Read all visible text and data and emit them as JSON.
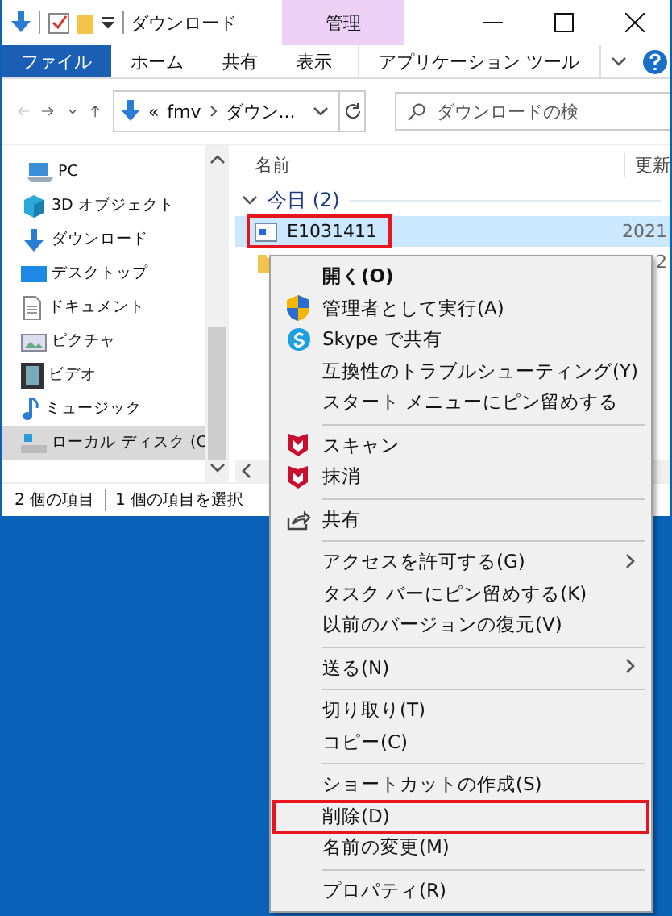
{
  "title_bar": {
    "title": "ダウンロード",
    "context_group": "管理"
  },
  "ribbon_tabs": [
    {
      "label": "ファイル",
      "kind": "file"
    },
    {
      "label": "ホーム",
      "kind": "tab"
    },
    {
      "label": "共有",
      "kind": "tab"
    },
    {
      "label": "表示",
      "kind": "tab"
    },
    {
      "label": "アプリケーション ツール",
      "kind": "context"
    }
  ],
  "address_bar": {
    "overflow": "«",
    "path": [
      "fmv",
      "ダウン..."
    ]
  },
  "search": {
    "placeholder": "ダウンロードの検"
  },
  "nav_pane": {
    "items": [
      {
        "label": "PC",
        "kind": "pc",
        "selected": false,
        "children": [
          {
            "label": "3D オブジェクト",
            "kind": "cube",
            "selected": false
          },
          {
            "label": "ダウンロード",
            "kind": "download",
            "selected": false
          },
          {
            "label": "デスクトップ",
            "kind": "desktop",
            "selected": false
          },
          {
            "label": "ドキュメント",
            "kind": "document",
            "selected": false
          },
          {
            "label": "ピクチャ",
            "kind": "picture",
            "selected": false
          },
          {
            "label": "ビデオ",
            "kind": "video",
            "selected": false
          },
          {
            "label": "ミュージック",
            "kind": "music",
            "selected": false
          },
          {
            "label": "ローカル ディスク (C",
            "kind": "drive",
            "selected": true
          }
        ]
      }
    ]
  },
  "file_list": {
    "columns": [
      "名前",
      "更新"
    ],
    "groups": [
      {
        "label": "今日 (2)",
        "expanded": true,
        "rows": [
          {
            "name": "E1031411",
            "modified": "2021",
            "kind": "app",
            "selected": true,
            "highlighted": true
          },
          {
            "modified": "2",
            "kind": "folder",
            "selected": false,
            "highlighted": false
          }
        ]
      }
    ]
  },
  "status_bar": [
    "2 個の項目",
    "1 個の項目を選択"
  ],
  "context_menu": {
    "sections": [
      [
        {
          "label": "開く(O)",
          "bold": true,
          "submenu": false,
          "highlighted": false
        },
        {
          "label": "管理者として実行(A)",
          "kind": "shield",
          "bold": false,
          "submenu": false,
          "highlighted": false
        },
        {
          "label": "Skype で共有",
          "kind": "skype",
          "bold": false,
          "submenu": false,
          "highlighted": false
        },
        {
          "label": "互換性のトラブルシューティング(Y)",
          "bold": false,
          "submenu": false,
          "highlighted": false
        },
        {
          "label": "スタート メニューにピン留めする",
          "bold": false,
          "submenu": false,
          "highlighted": false
        }
      ],
      [
        {
          "label": "スキャン",
          "kind": "antivirus",
          "bold": false,
          "submenu": false,
          "highlighted": false
        },
        {
          "label": "抹消",
          "kind": "antivirus",
          "bold": false,
          "submenu": false,
          "highlighted": false
        }
      ],
      [
        {
          "label": "共有",
          "kind": "share",
          "bold": false,
          "submenu": false,
          "highlighted": false
        }
      ],
      [
        {
          "label": "アクセスを許可する(G)",
          "bold": false,
          "submenu": true,
          "highlighted": false
        },
        {
          "label": "タスク バーにピン留めする(K)",
          "bold": false,
          "submenu": false,
          "highlighted": false
        },
        {
          "label": "以前のバージョンの復元(V)",
          "bold": false,
          "submenu": false,
          "highlighted": false
        }
      ],
      [
        {
          "label": "送る(N)",
          "bold": false,
          "submenu": true,
          "highlighted": false
        }
      ],
      [
        {
          "label": "切り取り(T)",
          "bold": false,
          "submenu": false,
          "highlighted": false
        },
        {
          "label": "コピー(C)",
          "bold": false,
          "submenu": false,
          "highlighted": false
        }
      ],
      [
        {
          "label": "ショートカットの作成(S)",
          "bold": false,
          "submenu": false,
          "highlighted": false
        },
        {
          "label": "削除(D)",
          "bold": false,
          "submenu": false,
          "highlighted": true
        },
        {
          "label": "名前の変更(M)",
          "bold": false,
          "submenu": false,
          "highlighted": false
        }
      ],
      [
        {
          "label": "プロパティ(R)",
          "bold": false,
          "submenu": false,
          "highlighted": false
        }
      ]
    ]
  }
}
